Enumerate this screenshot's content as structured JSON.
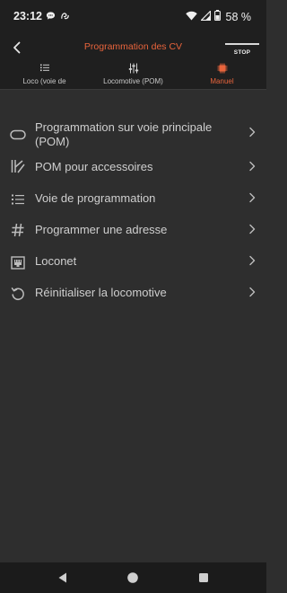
{
  "status_bar": {
    "time": "23:12",
    "battery": "58 %",
    "icons": [
      "chat-bubble-icon",
      "link-icon",
      "wifi-icon",
      "signal-icon",
      "battery-icon"
    ]
  },
  "header": {
    "title": "Programmation des CV",
    "stop_label": "STOP",
    "accent_color": "#e8643c"
  },
  "tabs": [
    {
      "label": "Loco (voie de",
      "icon": "list-icon",
      "active": false
    },
    {
      "label": "Locomotive (POM)",
      "icon": "sliders-icon",
      "active": false
    },
    {
      "label": "Manuel",
      "icon": "chip-icon",
      "active": true
    }
  ],
  "menu": {
    "items": [
      {
        "label": "Programmation sur voie principale (POM)",
        "icon": "track-loop-icon"
      },
      {
        "label": "POM pour accessoires",
        "icon": "switch-turnout-icon"
      },
      {
        "label": "Voie de programmation",
        "icon": "list-icon"
      },
      {
        "label": "Programmer une adresse",
        "icon": "hash-icon"
      },
      {
        "label": "Loconet",
        "icon": "loconet-icon"
      },
      {
        "label": "Réinitialiser la locomotive",
        "icon": "reset-icon"
      }
    ]
  },
  "nav_bar": {
    "buttons": [
      "back-triangle-icon",
      "home-circle-icon",
      "recents-square-icon"
    ]
  }
}
